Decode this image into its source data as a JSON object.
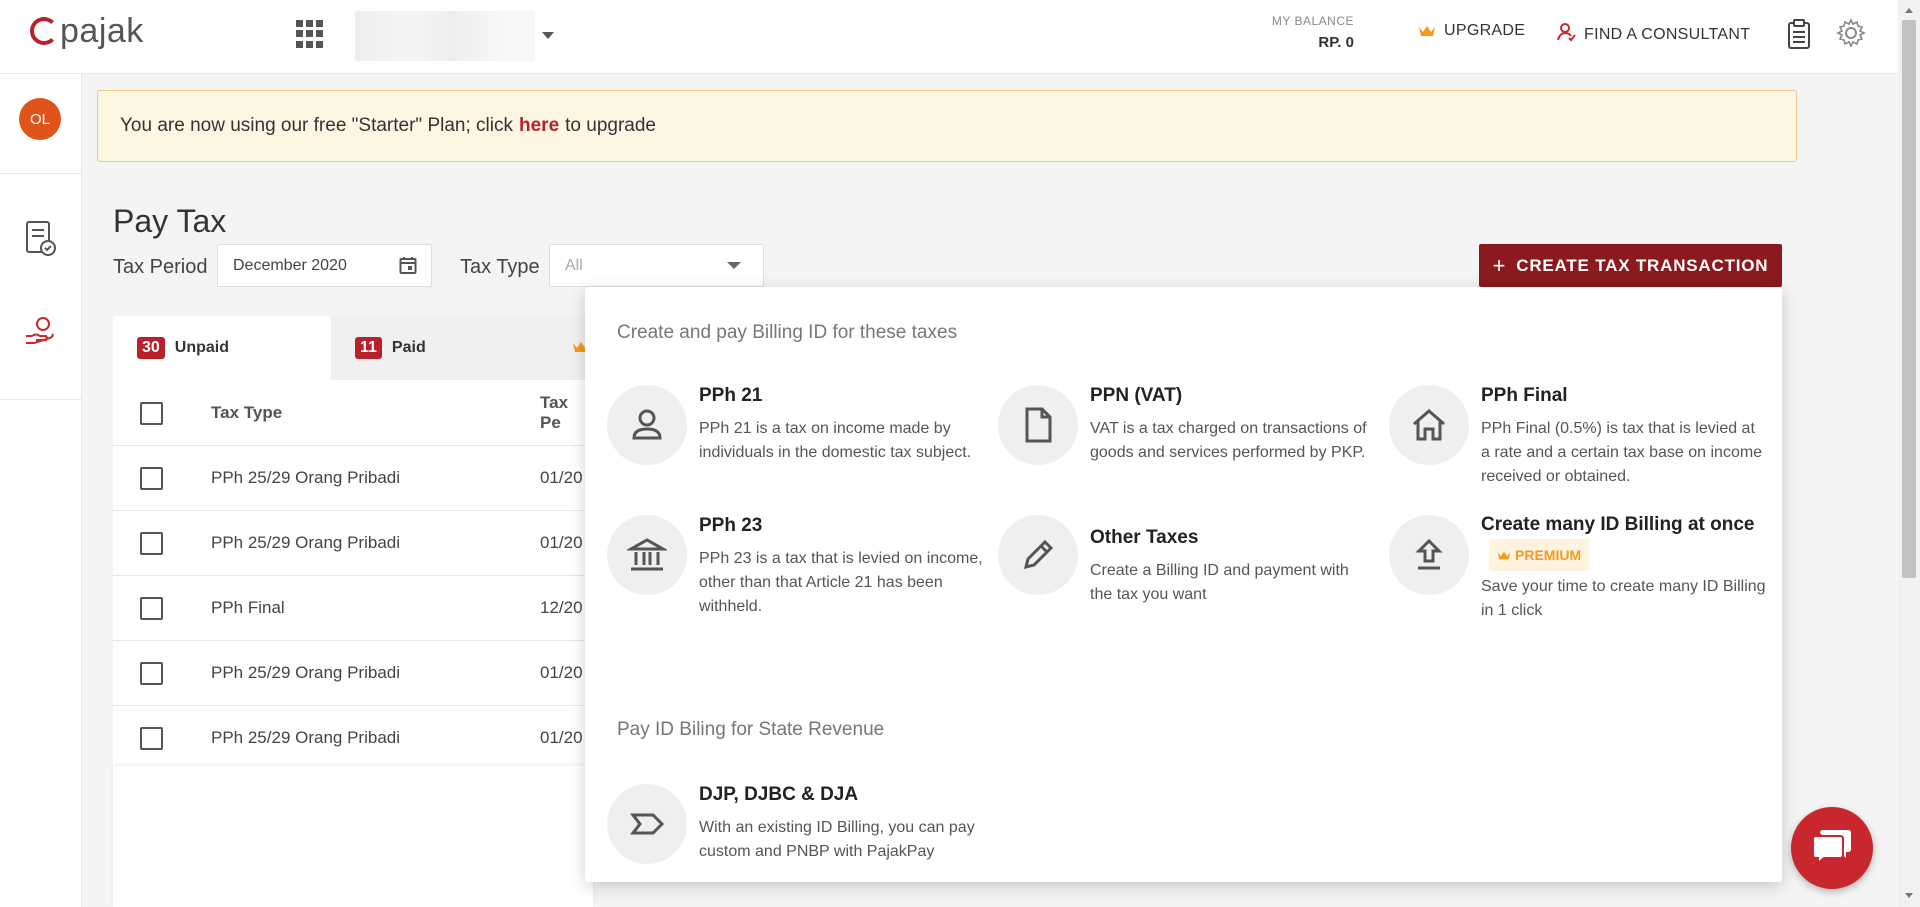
{
  "header": {
    "logo_text": "pajak",
    "balance_label": "MY BALANCE",
    "balance_value": "RP. 0",
    "upgrade_label": "UPGRADE",
    "consultant_label": "FIND A CONSULTANT"
  },
  "sidebar": {
    "avatar_initials": "OL"
  },
  "banner": {
    "text_before": "You are now using our free \"Starter\" Plan; click",
    "link_text": "here",
    "text_after": "to upgrade"
  },
  "page": {
    "title": "Pay Tax",
    "tax_period_label": "Tax Period",
    "tax_period_value": "December 2020",
    "tax_type_label": "Tax Type",
    "tax_type_value": "All",
    "create_button_label": "CREATE TAX TRANSACTION"
  },
  "tabs": [
    {
      "count": "30",
      "label": "Unpaid"
    },
    {
      "count": "11",
      "label": "Paid"
    }
  ],
  "table": {
    "headers": [
      "Tax Type",
      "Tax Pe"
    ],
    "rows": [
      {
        "type": "PPh 25/29 Orang Pribadi",
        "period": "01/20"
      },
      {
        "type": "PPh 25/29 Orang Pribadi",
        "period": "01/20"
      },
      {
        "type": "PPh Final",
        "period": "12/20"
      },
      {
        "type": "PPh 25/29 Orang Pribadi",
        "period": "01/20"
      },
      {
        "type": "PPh 25/29 Orang Pribadi",
        "period": "01/20"
      }
    ]
  },
  "menu": {
    "section1_title": "Create and pay Billing ID for these taxes",
    "section2_title": "Pay ID Biling for State Revenue",
    "items": [
      {
        "title": "PPh 21",
        "desc": "PPh 21 is a tax on income made by individuals in the domestic tax subject.",
        "icon": "person-icon"
      },
      {
        "title": "PPN (VAT)",
        "desc": "VAT is a tax charged on transactions of goods and services performed by PKP.",
        "icon": "document-icon"
      },
      {
        "title": "PPh Final",
        "desc": "PPh Final (0.5%) is tax that is levied at a rate and a certain tax base on income received or obtained.",
        "icon": "home-icon"
      },
      {
        "title": "PPh 23",
        "desc": "PPh 23 is a tax that is levied on income, other than that Article 21 has been withheld.",
        "icon": "bank-icon"
      },
      {
        "title": "Other Taxes",
        "desc": "Create a Billing ID and payment with the tax you want",
        "icon": "pencil-icon"
      },
      {
        "title": "Create many ID Billing at once",
        "desc": "Save your time to create many ID Billing in 1 click",
        "icon": "upload-icon",
        "badge": "PREMIUM"
      },
      {
        "title": "DJP, DJBC & DJA",
        "desc": "With an existing ID Billing, you can pay custom and PNBP with PajakPay",
        "icon": "label-icon"
      }
    ]
  },
  "colors": {
    "brand": "#b8202a",
    "primary_button": "#8b1a1e",
    "premium": "#f39a1f"
  }
}
